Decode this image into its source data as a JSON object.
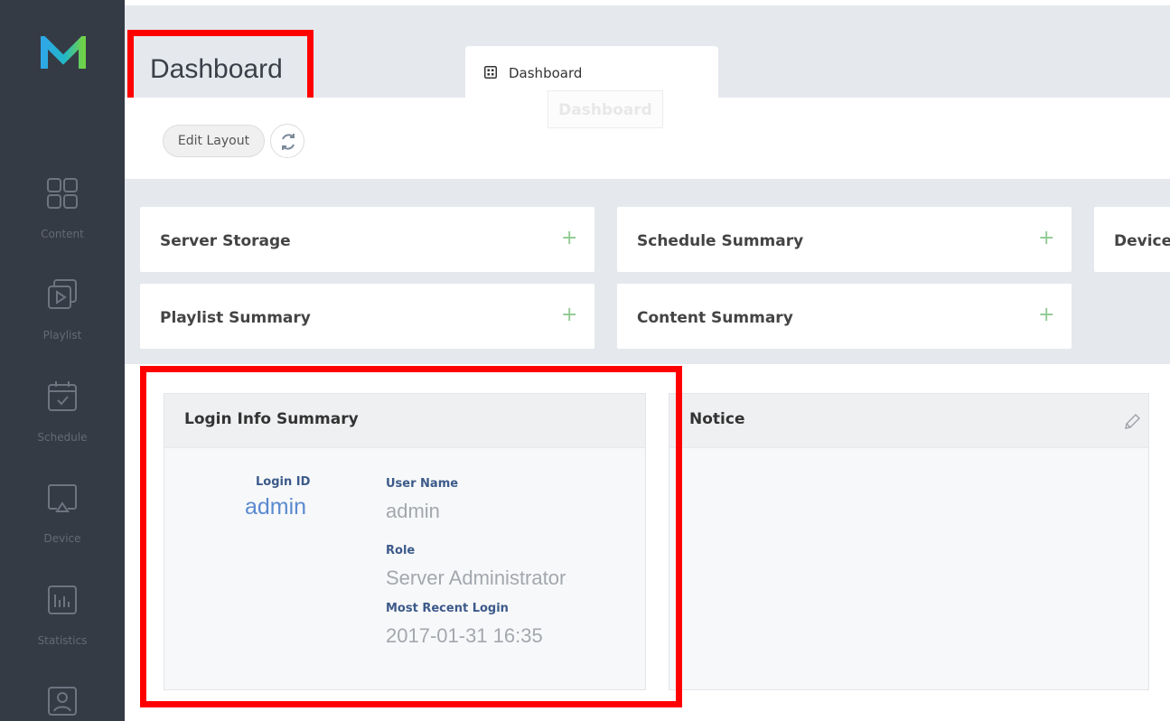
{
  "app": {
    "accent": "#5a8ad0",
    "sidebar_bg": "#353b45"
  },
  "header": {
    "title": "Dashboard"
  },
  "tabs": [
    {
      "label": "Dashboard",
      "icon": "grid-icon"
    }
  ],
  "ghost_tab": {
    "label": "Dashboard"
  },
  "toolbar": {
    "edit_label": "Edit Layout",
    "refresh_icon": "refresh-icon"
  },
  "sidebar": {
    "logo": "m-logo",
    "items": [
      {
        "label": "Content",
        "icon": "content-icon"
      },
      {
        "label": "Playlist",
        "icon": "playlist-icon"
      },
      {
        "label": "Schedule",
        "icon": "schedule-icon"
      },
      {
        "label": "Device",
        "icon": "device-icon"
      },
      {
        "label": "Statistics",
        "icon": "statistics-icon"
      },
      {
        "label": "",
        "icon": "user-icon"
      }
    ]
  },
  "widgets": [
    {
      "title": "Server Storage",
      "action": "+"
    },
    {
      "title": "Schedule Summary",
      "action": "+"
    },
    {
      "title": "Device"
    },
    {
      "title": "Playlist Summary",
      "action": "+"
    },
    {
      "title": "Content Summary",
      "action": "+"
    }
  ],
  "login_info": {
    "title": "Login Info Summary",
    "login_id_label": "Login ID",
    "login_id": "admin",
    "user_name_label": "User Name",
    "user_name": "admin",
    "role_label": "Role",
    "role": "Server Administrator",
    "recent_login_label": "Most Recent Login",
    "recent_login": "2017-01-31 16:35"
  },
  "notice": {
    "title": "Notice",
    "edit_icon": "pencil-icon"
  }
}
